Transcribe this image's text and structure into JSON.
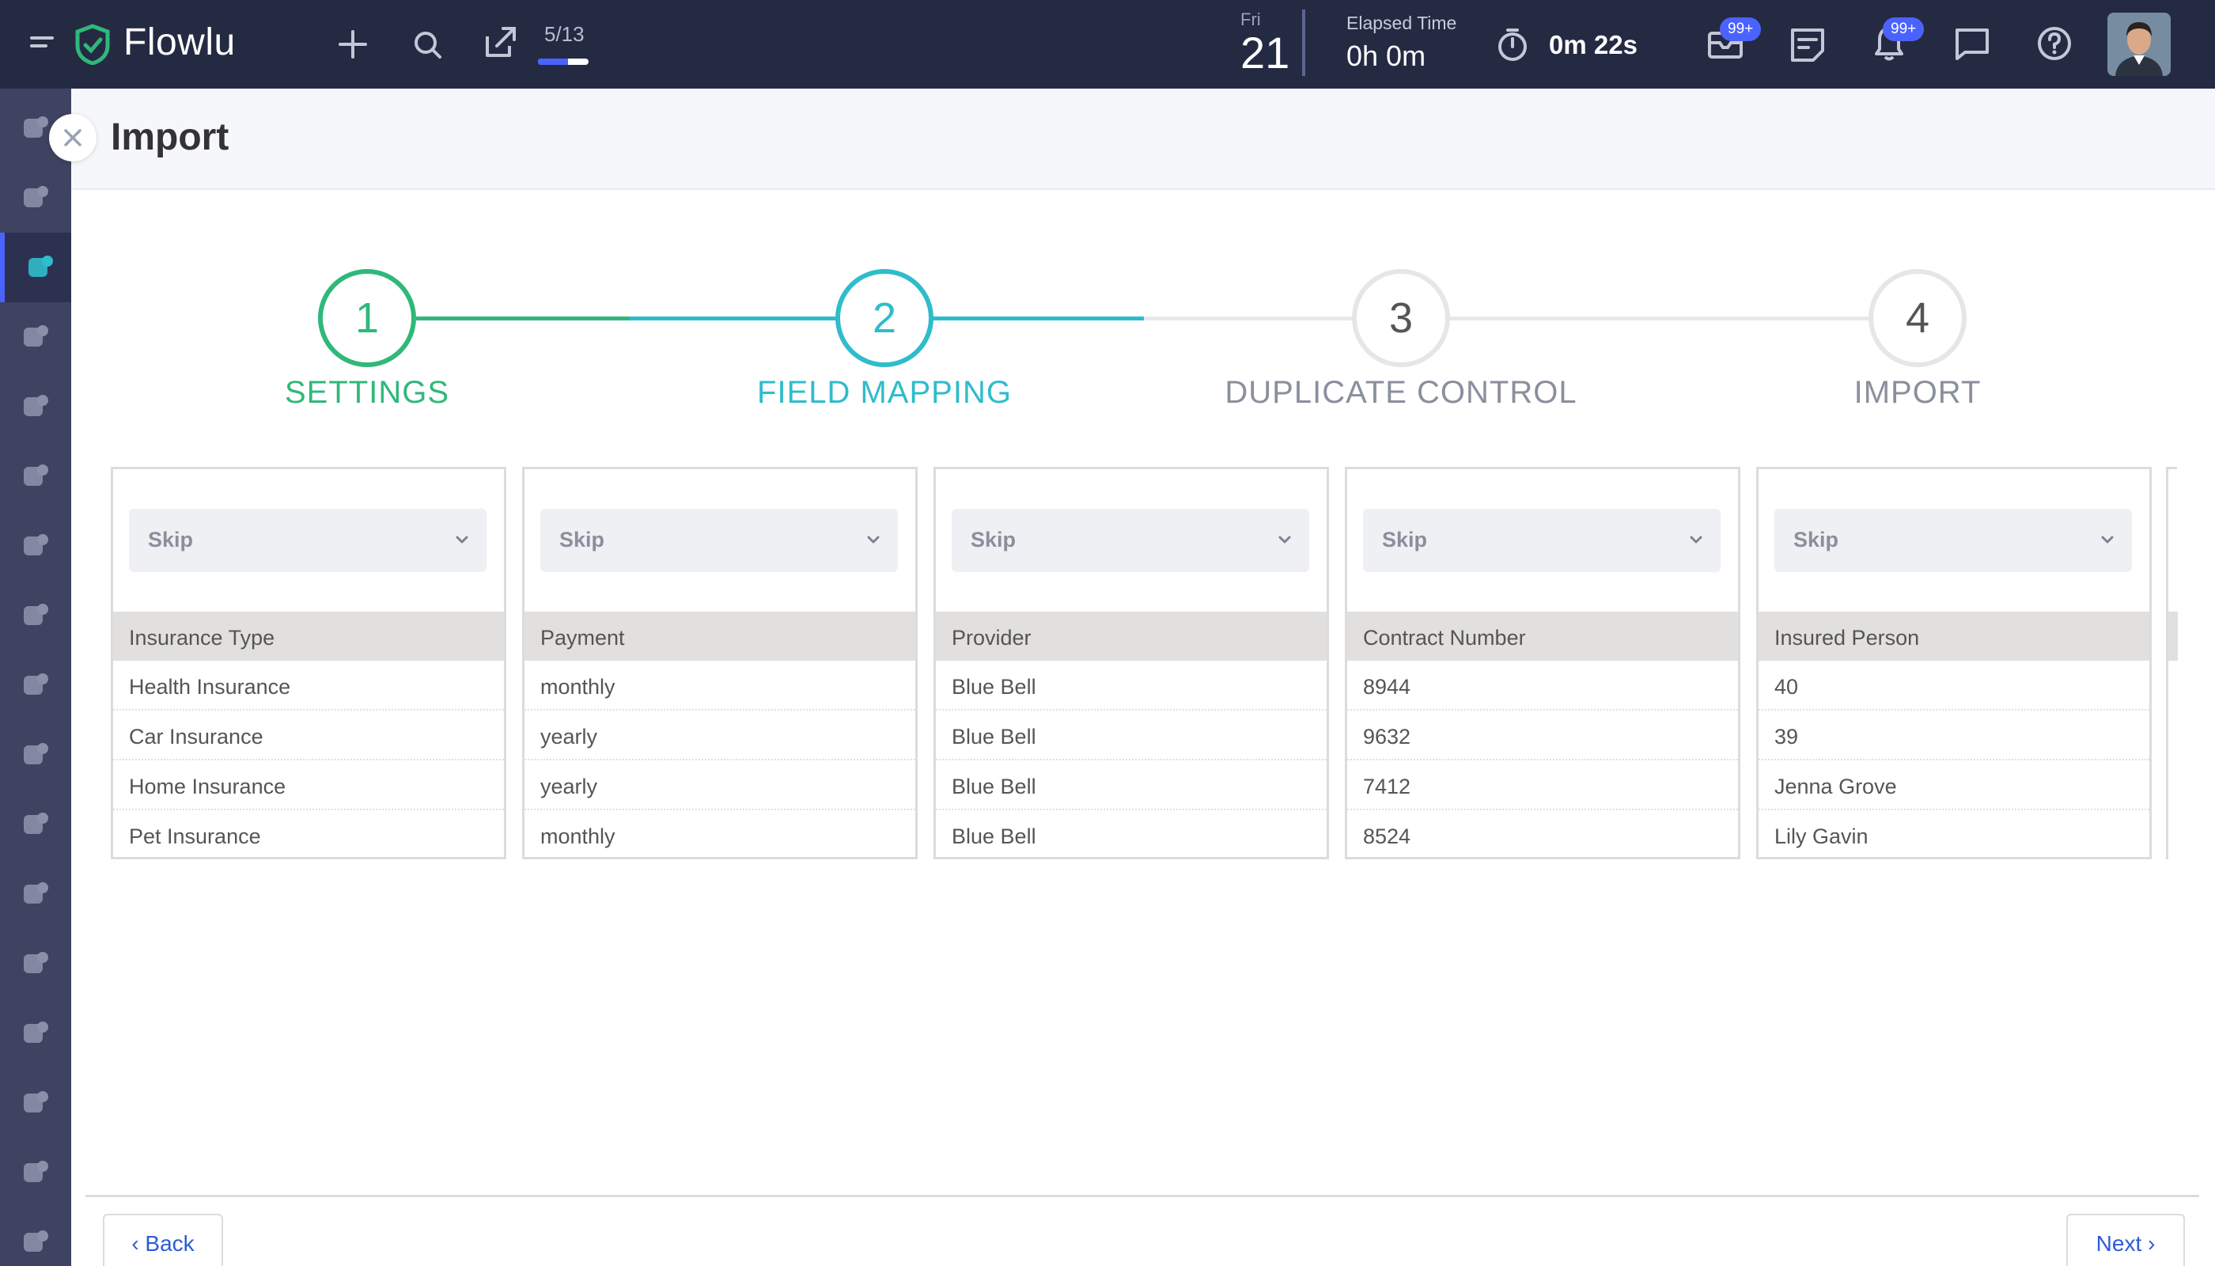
{
  "app": {
    "name": "Flowlu"
  },
  "topbar": {
    "progress": {
      "count_label": "5/13",
      "fraction": 0.6
    },
    "date": {
      "day_name": "Fri",
      "day_number": "21"
    },
    "elapsed": {
      "label": "Elapsed Time",
      "value": "0h 0m"
    },
    "timer": {
      "value": "0m 22s"
    },
    "mail_badge": "99+",
    "notification_badge": "99+"
  },
  "page": {
    "title": "Import"
  },
  "stepper": {
    "steps": [
      {
        "number": "1",
        "label": "SETTINGS",
        "state": "completed",
        "color": "#2fb87a"
      },
      {
        "number": "2",
        "label": "FIELD MAPPING",
        "state": "active",
        "color": "#2fbccb"
      },
      {
        "number": "3",
        "label": "DUPLICATE CONTROL",
        "state": "pending",
        "color": "#8a8f9c"
      },
      {
        "number": "4",
        "label": "IMPORT",
        "state": "pending",
        "color": "#8a8f9c"
      }
    ]
  },
  "mapping": {
    "columns": [
      {
        "select": "Skip",
        "header": "Insurance Type",
        "rows": [
          "Health Insurance",
          "Car Insurance",
          "Home Insurance",
          "Pet Insurance"
        ]
      },
      {
        "select": "Skip",
        "header": "Payment",
        "rows": [
          "monthly",
          "yearly",
          "yearly",
          "monthly"
        ]
      },
      {
        "select": "Skip",
        "header": "Provider",
        "rows": [
          "Blue Bell",
          "Blue Bell",
          "Blue Bell",
          "Blue Bell"
        ]
      },
      {
        "select": "Skip",
        "header": "Contract Number",
        "rows": [
          "8944",
          "9632",
          "7412",
          "8524"
        ]
      },
      {
        "select": "Skip",
        "header": "Insured Person",
        "rows": [
          "40",
          "39",
          "Jenna Grove",
          "Lily Gavin"
        ]
      }
    ]
  },
  "footer": {
    "back_label": "‹ Back",
    "next_label": "Next ›"
  },
  "colors": {
    "topbar": "#252a43",
    "sidebar": "#3d4360",
    "accent_blue": "#4a63ff",
    "link_blue": "#2d5bd7"
  }
}
